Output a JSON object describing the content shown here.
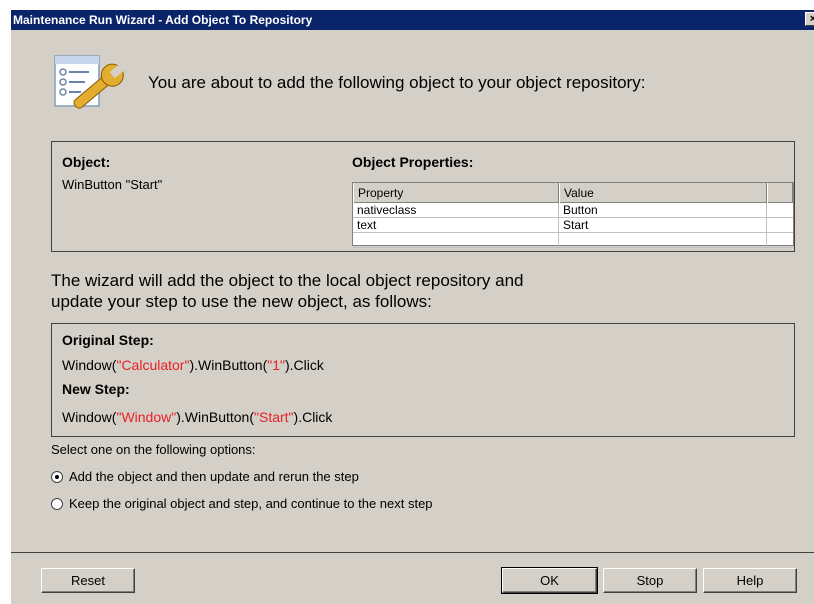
{
  "window": {
    "title": "Maintenance Run Wizard - Add Object To Repository",
    "close_glyph": "×"
  },
  "intro_text": "You are about to add the following object to your object repository:",
  "header_icon": "object-repository-wrench-icon",
  "object_panel": {
    "object_label": "Object:",
    "object_value": "WinButton \"Start\"",
    "properties_label": "Object Properties:",
    "columns": [
      "Property",
      "Value"
    ],
    "rows": [
      {
        "property": "nativeclass",
        "value": "Button"
      },
      {
        "property": "text",
        "value": "Start"
      }
    ]
  },
  "wizard_text_line1": "The wizard will add the object to the local object repository and",
  "wizard_text_line2": "update your step to use the new object, as follows:",
  "steps": {
    "original_label": "Original Step:",
    "original": {
      "p1": "Window(",
      "p2": "\"Calculator\"",
      "p3": ").WinButton(",
      "p4": "\"1\"",
      "p5": ").Click"
    },
    "new_label": "New Step:",
    "new": {
      "p1": "Window(",
      "p2": "\"Window\"",
      "p3": ").WinButton(",
      "p4": "\"Start\"",
      "p5": ").Click"
    }
  },
  "options_label": "Select one on the following options:",
  "options": [
    {
      "label": "Add the object and then update and rerun the step",
      "selected": true
    },
    {
      "label": "Keep the original object and step, and continue to the next step",
      "selected": false
    }
  ],
  "buttons": {
    "reset": "Reset",
    "ok": "OK",
    "stop": "Stop",
    "help": "Help"
  },
  "colors": {
    "highlight": "#e8202a",
    "titlebar": "#0a246a",
    "face": "#d4d0c8"
  }
}
